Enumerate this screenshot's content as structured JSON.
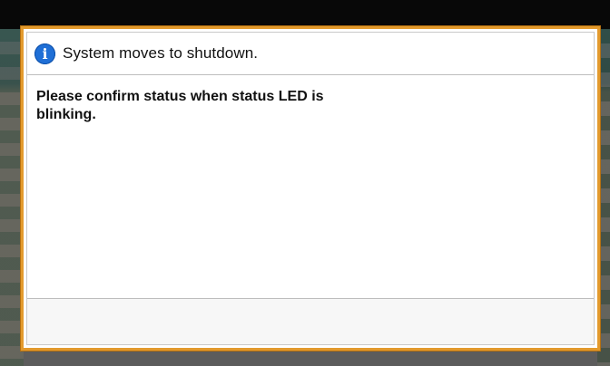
{
  "dialog": {
    "icon": "info-icon",
    "icon_glyph": "i",
    "title": "System moves to shutdown.",
    "message": "Please confirm status when status LED is blinking."
  },
  "colors": {
    "dialog_border": "#e39a2d",
    "info_icon": "#1f6fd6",
    "top_bar": "#080808"
  }
}
